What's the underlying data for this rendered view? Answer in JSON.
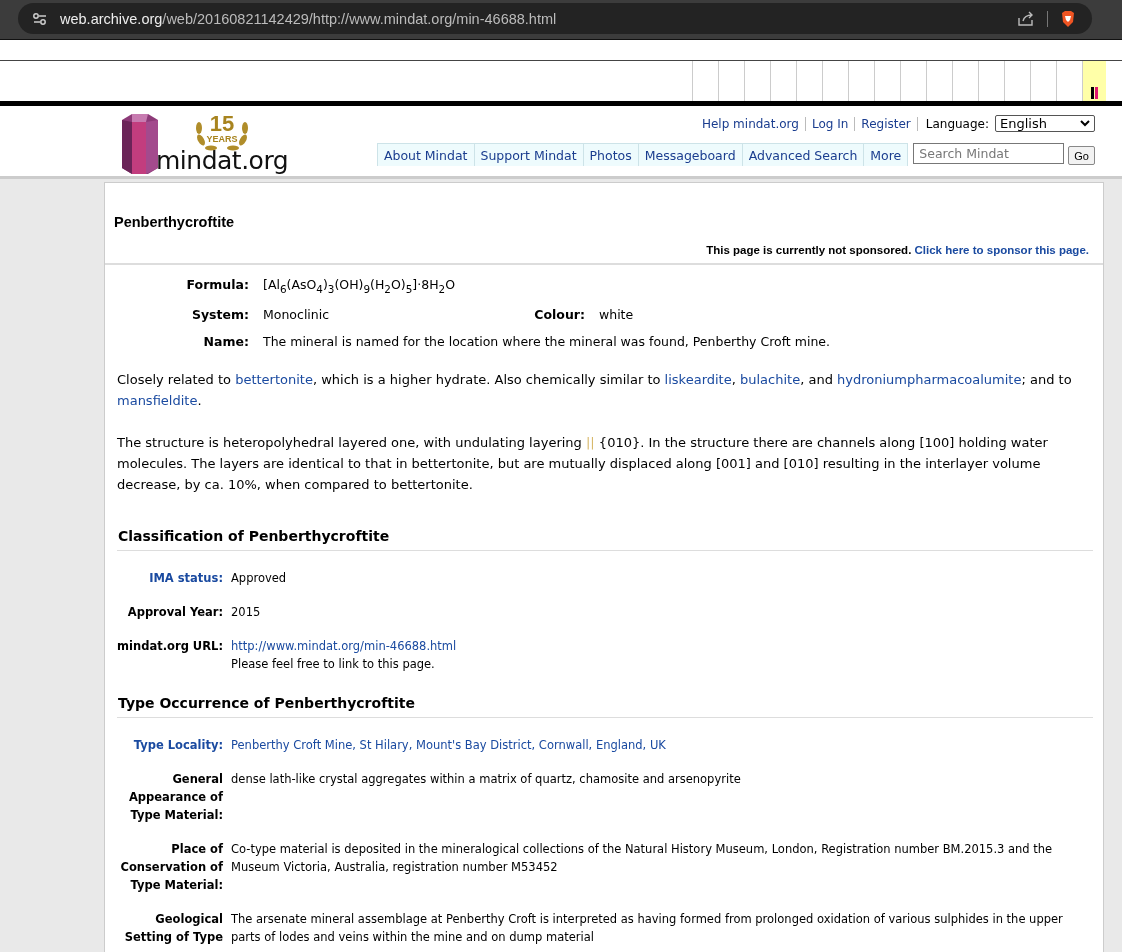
{
  "browser": {
    "url_host": "web.archive.org",
    "url_path": "/web/20160821142429/http://www.mindat.org/min-46688.html"
  },
  "header": {
    "logo": {
      "badge_number": "15",
      "badge_word": "YEARS",
      "wordmark": "mindat.org"
    },
    "top_links": [
      "Help mindat.org",
      "Log In",
      "Register"
    ],
    "language_label": "Language:",
    "language_value": "English",
    "nav": [
      "About Mindat",
      "Support Mindat",
      "Photos",
      "Messageboard",
      "Advanced Search",
      "More"
    ],
    "search": {
      "placeholder": "Search Mindat"
    },
    "go_button": "Go"
  },
  "title": "Penberthycroftite",
  "sponsor": {
    "text": "This page is currently not sponsored.",
    "link": "Click here to sponsor this page."
  },
  "formula": {
    "label": "Formula:",
    "value": "[Al$_{6}$(AsO$_{4}$)$_{3}$(OH)$_{9}$(H$_{2}$O)$_{5}$]·8H$_{2}$O"
  },
  "system": {
    "label": "System:",
    "value": "Monoclinic"
  },
  "colour": {
    "label": "Colour:",
    "value": "white"
  },
  "name": {
    "label": "Name:",
    "value": "The mineral is named for the location where the mineral was found, Penberthy Croft mine."
  },
  "paragraphs": [
    [
      {
        "kind": "text",
        "text": "Closely related to "
      },
      {
        "kind": "link",
        "text": "bettertonite"
      },
      {
        "kind": "text",
        "text": ", which is a higher hydrate. Also chemically similar to "
      },
      {
        "kind": "link",
        "text": "liskeardite"
      },
      {
        "kind": "text",
        "text": ", "
      },
      {
        "kind": "link",
        "text": "bulachite"
      },
      {
        "kind": "text",
        "text": ", and "
      },
      {
        "kind": "link",
        "text": "hydroniumpharmacoalumite"
      },
      {
        "kind": "text",
        "text": "; and to "
      },
      {
        "kind": "link",
        "text": "mansfieldite"
      },
      {
        "kind": "text",
        "text": "."
      }
    ],
    [
      {
        "kind": "text",
        "text": "The structure is heteropolyhedral layered one, with undulating layering "
      },
      {
        "kind": "symbol",
        "text": "||"
      },
      {
        "kind": "text",
        "text": " {010}. In the structure there are channels along [100] holding water molecules. The layers are identical to that in bettertonite, but are mutually displaced along [001] and [010] resulting in the interlayer volume decrease, by ca. 10%, when compared to bettertonite."
      }
    ]
  ],
  "sections": [
    {
      "heading": "Classification of Penberthycroftite",
      "rows": [
        {
          "label": "IMA status:",
          "label_link": true,
          "value": "Approved",
          "value_link": false
        },
        {
          "label": "Approval Year:",
          "label_link": false,
          "value": "2015",
          "value_link": false
        },
        {
          "label": "mindat.org URL:",
          "label_link": false,
          "value": "http://www.mindat.org/min-46688.html",
          "value_link": true,
          "note": "Please feel free to link to this page."
        }
      ]
    },
    {
      "heading": "Type Occurrence of Penberthycroftite",
      "rows": [
        {
          "label": "Type Locality:",
          "label_link": true,
          "value": "Penberthy Croft Mine, St Hilary, Mount's Bay District, Cornwall, England, UK",
          "value_link": true
        },
        {
          "label": "General Appearance of Type Material:",
          "label_link": false,
          "value": "dense lath-like crystal aggregates within a matrix of quartz, chamosite and arsenopyrite",
          "value_link": false
        },
        {
          "label": "Place of Conservation of Type Material:",
          "label_link": false,
          "value": "Co-type material is deposited in the mineralogical collections of the Natural History Museum, London, Registration number BM.2015.3 and the Museum Victoria, Australia, registration number M53452",
          "value_link": false
        },
        {
          "label": "Geological Setting of Type",
          "label_link": false,
          "value": "The arsenate mineral assemblage at Penberthy Croft is interpreted as having formed from prolonged oxidation of various sulphides in the upper parts of lodes and veins within the mine and on dump material",
          "value_link": false
        }
      ]
    }
  ]
}
